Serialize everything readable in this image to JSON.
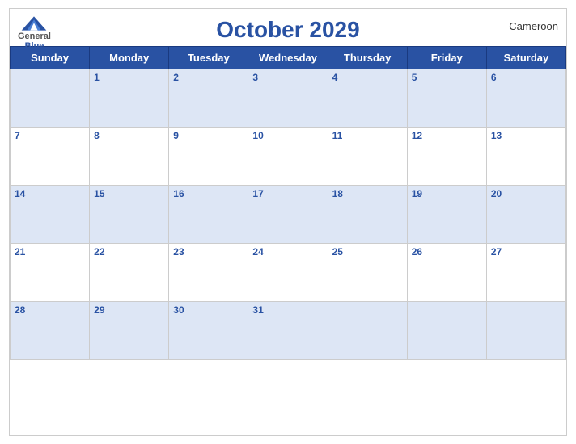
{
  "header": {
    "title": "October 2029",
    "country": "Cameroon",
    "logo": {
      "general": "General",
      "blue": "Blue"
    }
  },
  "days_of_week": [
    "Sunday",
    "Monday",
    "Tuesday",
    "Wednesday",
    "Thursday",
    "Friday",
    "Saturday"
  ],
  "weeks": [
    [
      null,
      1,
      2,
      3,
      4,
      5,
      6
    ],
    [
      7,
      8,
      9,
      10,
      11,
      12,
      13
    ],
    [
      14,
      15,
      16,
      17,
      18,
      19,
      20
    ],
    [
      21,
      22,
      23,
      24,
      25,
      26,
      27
    ],
    [
      28,
      29,
      30,
      31,
      null,
      null,
      null
    ]
  ],
  "accent_color": "#2952a3",
  "row_bg_color": "#dde6f5"
}
